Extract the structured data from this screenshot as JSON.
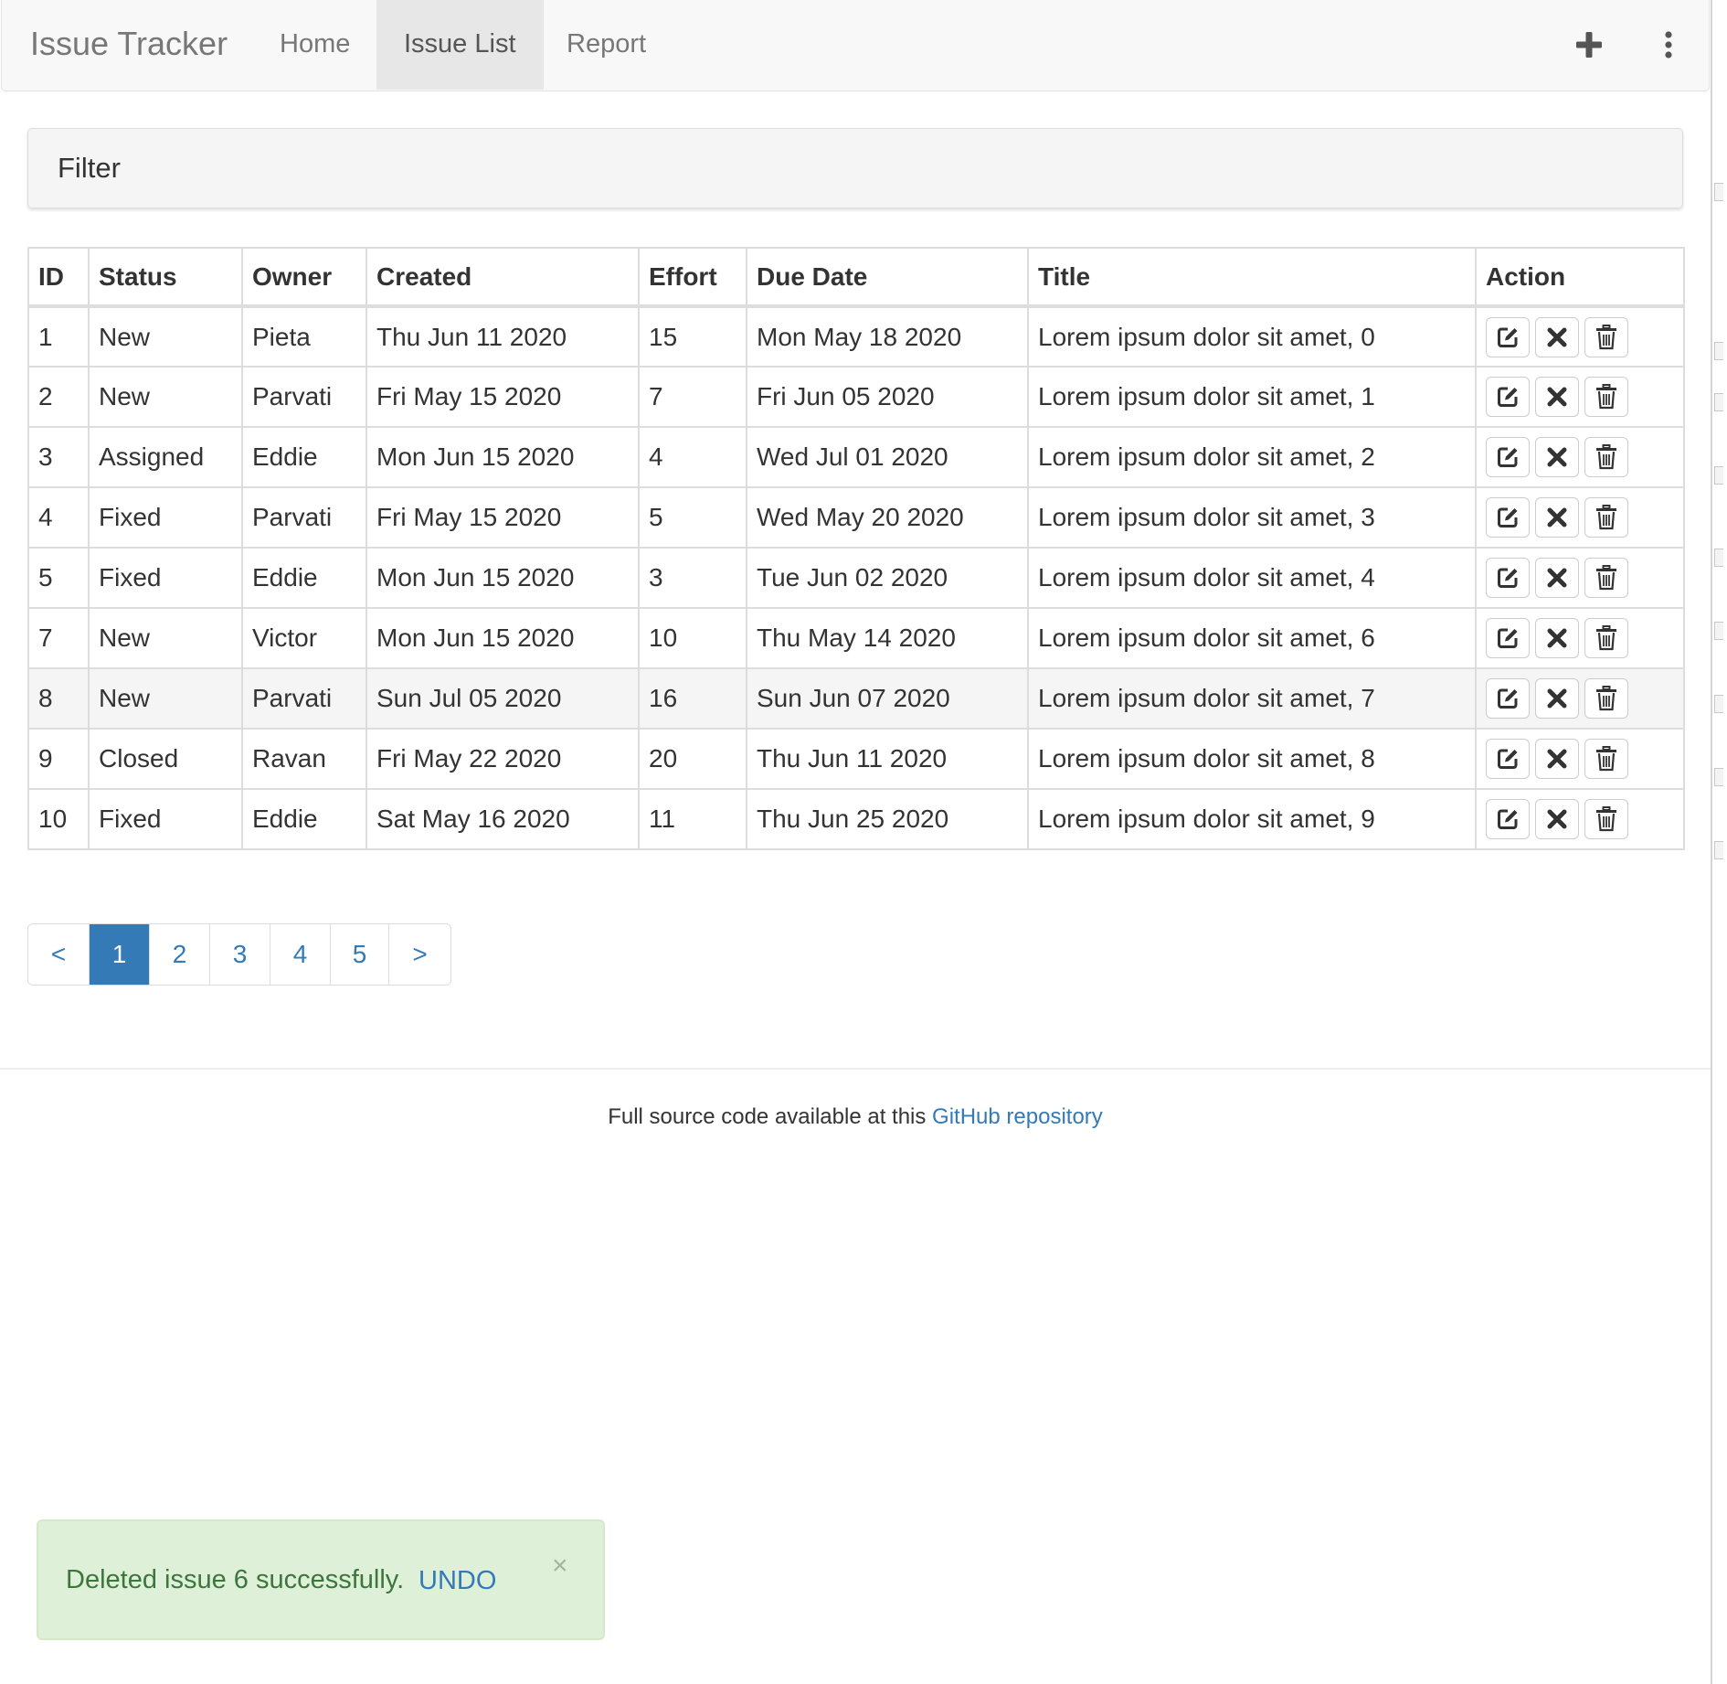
{
  "navbar": {
    "brand": "Issue Tracker",
    "items": [
      {
        "label": "Home"
      },
      {
        "label": "Issue List"
      },
      {
        "label": "Report"
      }
    ],
    "active_item": "Issue List",
    "icons": [
      "plus-icon",
      "vertical-ellipsis-icon"
    ]
  },
  "filter": {
    "title": "Filter"
  },
  "table": {
    "headers": [
      "ID",
      "Status",
      "Owner",
      "Created",
      "Effort",
      "Due Date",
      "Title",
      "Action"
    ],
    "rows": [
      {
        "id": "1",
        "status": "New",
        "owner": "Pieta",
        "created": "Thu Jun 11 2020",
        "effort": "15",
        "due": "Mon May 18 2020",
        "title": "Lorem ipsum dolor sit amet, 0"
      },
      {
        "id": "2",
        "status": "New",
        "owner": "Parvati",
        "created": "Fri May 15 2020",
        "effort": "7",
        "due": "Fri Jun 05 2020",
        "title": "Lorem ipsum dolor sit amet, 1"
      },
      {
        "id": "3",
        "status": "Assigned",
        "owner": "Eddie",
        "created": "Mon Jun 15 2020",
        "effort": "4",
        "due": "Wed Jul 01 2020",
        "title": "Lorem ipsum dolor sit amet, 2"
      },
      {
        "id": "4",
        "status": "Fixed",
        "owner": "Parvati",
        "created": "Fri May 15 2020",
        "effort": "5",
        "due": "Wed May 20 2020",
        "title": "Lorem ipsum dolor sit amet, 3"
      },
      {
        "id": "5",
        "status": "Fixed",
        "owner": "Eddie",
        "created": "Mon Jun 15 2020",
        "effort": "3",
        "due": "Tue Jun 02 2020",
        "title": "Lorem ipsum dolor sit amet, 4"
      },
      {
        "id": "7",
        "status": "New",
        "owner": "Victor",
        "created": "Mon Jun 15 2020",
        "effort": "10",
        "due": "Thu May 14 2020",
        "title": "Lorem ipsum dolor sit amet, 6"
      },
      {
        "id": "8",
        "status": "New",
        "owner": "Parvati",
        "created": "Sun Jul 05 2020",
        "effort": "16",
        "due": "Sun Jun 07 2020",
        "title": "Lorem ipsum dolor sit amet, 7"
      },
      {
        "id": "9",
        "status": "Closed",
        "owner": "Ravan",
        "created": "Fri May 22 2020",
        "effort": "20",
        "due": "Thu Jun 11 2020",
        "title": "Lorem ipsum dolor sit amet, 8"
      },
      {
        "id": "10",
        "status": "Fixed",
        "owner": "Eddie",
        "created": "Sat May 16 2020",
        "effort": "11",
        "due": "Thu Jun 25 2020",
        "title": "Lorem ipsum dolor sit amet, 9"
      }
    ],
    "hovered_row_id": "8",
    "action_icons": [
      "edit-icon",
      "close-icon",
      "trash-icon"
    ]
  },
  "pagination": {
    "prev": "<",
    "pages": [
      "1",
      "2",
      "3",
      "4",
      "5"
    ],
    "next": ">",
    "current": "1"
  },
  "footer": {
    "text": "Full source code available at this",
    "link_text": "GitHub repository"
  },
  "toast": {
    "message": "Deleted issue 6 successfully.",
    "undo": "UNDO",
    "close": "×"
  },
  "colors": {
    "link": "#337ab7",
    "toast_bg": "#dff0d8",
    "toast_text": "#3c763d",
    "navbar_bg": "#f8f8f8",
    "nav_active_bg": "#e7e7e7"
  }
}
